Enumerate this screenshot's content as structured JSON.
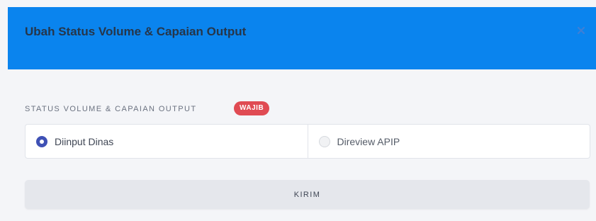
{
  "modal": {
    "title": "Ubah Status Volume & Capaian Output",
    "close_icon": "close-icon",
    "header_color": "#0a84ee"
  },
  "form": {
    "field_label": "STATUS VOLUME & CAPAIAN OUTPUT",
    "badge": "WAJIB",
    "badge_color": "#e04b53",
    "options": [
      {
        "label": "Diinput Dinas",
        "selected": true
      },
      {
        "label": "Direview APIP",
        "selected": false
      }
    ],
    "submit_label": "KIRIM"
  }
}
